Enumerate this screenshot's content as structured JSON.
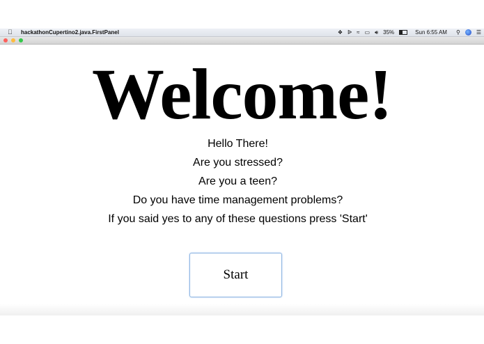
{
  "menubar": {
    "app_title": "hackathonCupertino2.java.FirstPanel",
    "battery_percent": "35%",
    "clock": "Sun 6:55 AM",
    "icons": [
      "apple-icon",
      "dropbox-icon",
      "bluetooth-icon",
      "wifi-icon",
      "airplay-icon",
      "volume-icon",
      "battery-icon",
      "search-icon",
      "siri-icon",
      "notification-center-icon"
    ]
  },
  "window": {
    "controls": [
      "close",
      "minimize",
      "zoom"
    ]
  },
  "main": {
    "heading": "Welcome!",
    "lines": [
      "Hello There!",
      "Are you stressed?",
      "Are you a teen?",
      "Do you have time management problems?",
      "If you said yes to any of these questions press 'Start'"
    ],
    "start_label": "Start"
  }
}
